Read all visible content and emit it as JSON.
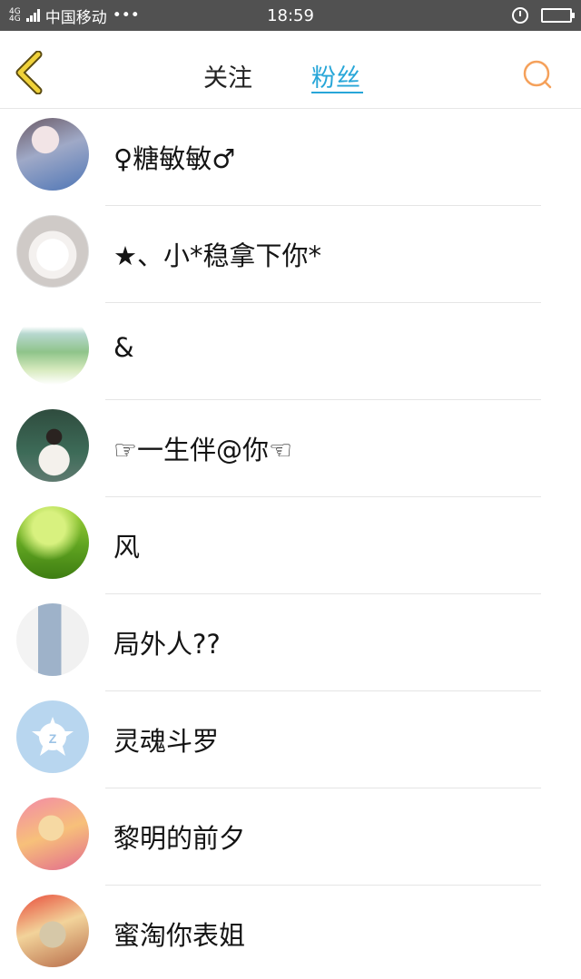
{
  "status_bar": {
    "network_top": "4G",
    "network_bottom": "4G",
    "carrier": "中国移动",
    "more": "•••",
    "time": "18:59"
  },
  "header": {
    "tab_follow": "关注",
    "tab_fans": "粉丝",
    "active_tab": "粉丝",
    "accent_color": "#27a6d8",
    "search_color": "#f5a15b",
    "back_color": "#e8c030"
  },
  "fans": [
    {
      "name": "♀糖敏敏♂"
    },
    {
      "name": "★、小*稳拿下你*"
    },
    {
      "name": "&"
    },
    {
      "name": "☞一生伴@你☜"
    },
    {
      "name": "风"
    },
    {
      "name": "局外人??"
    },
    {
      "name": "灵魂斗罗"
    },
    {
      "name": "黎明的前夕"
    },
    {
      "name": "蜜淘你表姐"
    }
  ]
}
